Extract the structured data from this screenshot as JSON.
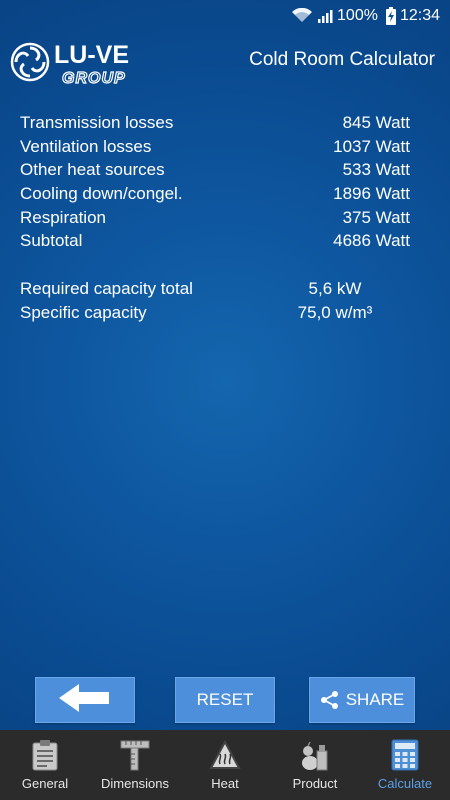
{
  "status_bar": {
    "battery": "100%",
    "time": "12:34"
  },
  "header": {
    "logo_text_main": "LU-VE",
    "logo_text_sub": "GROUP",
    "title": "Cold Room Calculator"
  },
  "results": {
    "items": [
      {
        "label": "Transmission losses",
        "value": "845 Watt"
      },
      {
        "label": "Ventilation losses",
        "value": "1037 Watt"
      },
      {
        "label": "Other heat sources",
        "value": "533 Watt"
      },
      {
        "label": "Cooling down/congel.",
        "value": "1896 Watt"
      },
      {
        "label": "Respiration",
        "value": "375 Watt"
      },
      {
        "label": "Subtotal",
        "value": "4686 Watt"
      }
    ],
    "totals": [
      {
        "label": "Required capacity total",
        "value": "5,6 kW"
      },
      {
        "label": "Specific capacity",
        "value": "75,0 w/m³"
      }
    ]
  },
  "buttons": {
    "reset_label": "RESET",
    "share_label": "SHARE"
  },
  "nav": {
    "items": [
      {
        "label": "General",
        "icon": "clipboard-icon"
      },
      {
        "label": "Dimensions",
        "icon": "ruler-icon"
      },
      {
        "label": "Heat",
        "icon": "heat-warning-icon"
      },
      {
        "label": "Product",
        "icon": "product-icon"
      },
      {
        "label": "Calculate",
        "icon": "calculator-icon"
      }
    ],
    "active_index": 4,
    "active_color": "#5aa0e6"
  },
  "colors": {
    "background": "#0a4a8f",
    "button": "#4d8fdb",
    "nav_background": "#2b2b2b"
  }
}
